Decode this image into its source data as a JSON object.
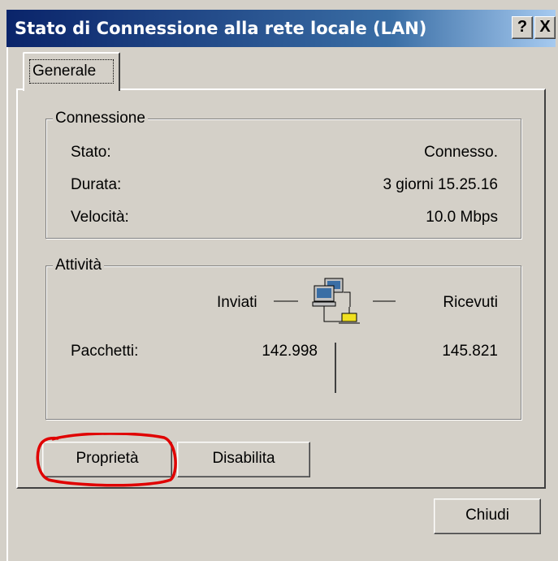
{
  "window": {
    "title": "Stato di Connessione alla rete locale (LAN)",
    "help_label": "?",
    "close_label": "X"
  },
  "tabs": [
    {
      "label": "Generale"
    }
  ],
  "connection": {
    "legend": "Connessione",
    "rows": [
      {
        "label": "Stato:",
        "value": "Connesso."
      },
      {
        "label": "Durata:",
        "value": "3 giorni 15.25.16"
      },
      {
        "label": "Velocità:",
        "value": "10.0 Mbps"
      }
    ]
  },
  "activity": {
    "legend": "Attività",
    "sent_label": "Inviati",
    "received_label": "Ricevuti",
    "packets_label": "Pacchetti:",
    "packets_sent": "142.998",
    "packets_received": "145.821",
    "icon": "network-computers-icon"
  },
  "buttons": {
    "properties": "Proprietà",
    "disable": "Disabilita",
    "close": "Chiudi"
  },
  "annotation": {
    "color": "#e00000",
    "target": "properties-button"
  },
  "colors": {
    "titlebar_start": "#0a246a",
    "titlebar_end": "#a6caf0",
    "face": "#d4d0c8"
  }
}
